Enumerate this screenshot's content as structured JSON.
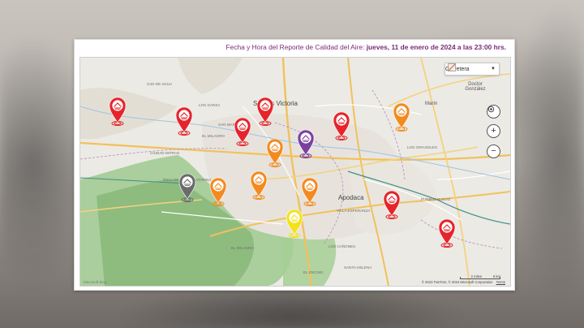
{
  "header": {
    "prefix": "Fecha y Hora del Reporte de Calidad del Aire:",
    "datetime": "jueves, 11 de enero de 2024 a las 23:00 hrs."
  },
  "map": {
    "style_selector": {
      "selected": "Carretera",
      "icon": "map-style-icon"
    },
    "controls": [
      "locate-button",
      "zoom-in-button",
      "zoom-out-button"
    ],
    "attribution": {
      "text": "© 2023 TomTom, © 2024 Microsoft Corporation",
      "terms": "Terms"
    },
    "scale": {
      "left": "2 miles",
      "right": "5 km"
    },
    "provider_logo": "Microsoft Bing",
    "places": {
      "salinas_victoria": "Salinas Victoria",
      "apodaca": "Apodaca",
      "marin": "Marín",
      "doctor_gonzalez": "Doctor González",
      "ojo_de_agua": "Ojo de Agua",
      "los_garza": "Los Garza",
      "san_martin": "San Martín",
      "el_milagro": "El Milagro",
      "ciudad_mitras": "Ciudad Mitras",
      "real_santa_catarina": "Real de Santa Catarina",
      "los_girasoles": "Los Girasoles",
      "pueblo_nuevo": "Pueblo Nuevo",
      "villa_esperanza": "Villa Esperanza",
      "el_encino": "El Encino",
      "santa_helena": "Santa Helena",
      "los_canones": "Los Cañones",
      "el_milagro_2": "El Milagro"
    },
    "colors": {
      "red": "#e5242b",
      "orange": "#f38a1f",
      "purple": "#7b3fa0",
      "gray": "#6b6b6b",
      "yellow": "#f2e21b",
      "header_text": "#7a2a7a"
    },
    "stations": [
      {
        "name": "station-1",
        "level": "red"
      },
      {
        "name": "station-2",
        "level": "red"
      },
      {
        "name": "station-3",
        "level": "red"
      },
      {
        "name": "station-4",
        "level": "red"
      },
      {
        "name": "station-5",
        "level": "red"
      },
      {
        "name": "station-6",
        "level": "orange"
      },
      {
        "name": "station-7",
        "level": "orange"
      },
      {
        "name": "station-8",
        "level": "purple"
      },
      {
        "name": "station-9",
        "level": "gray"
      },
      {
        "name": "station-10",
        "level": "orange"
      },
      {
        "name": "station-11",
        "level": "orange"
      },
      {
        "name": "station-12",
        "level": "orange"
      },
      {
        "name": "station-13",
        "level": "red"
      },
      {
        "name": "station-14",
        "level": "yellow"
      },
      {
        "name": "station-15",
        "level": "red"
      }
    ]
  }
}
